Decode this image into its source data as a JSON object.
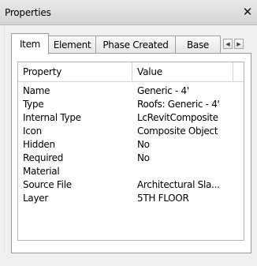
{
  "window": {
    "title": "Properties",
    "close_glyph": "✕"
  },
  "tabs": [
    {
      "label": "Item",
      "active": true
    },
    {
      "label": "Element",
      "active": false
    },
    {
      "label": "Phase Created",
      "active": false
    },
    {
      "label": "Base",
      "active": false
    }
  ],
  "tab_scroll": {
    "left_icon": "scroll-left-icon",
    "right_icon": "scroll-right-icon",
    "left_glyph": "◀",
    "right_glyph": "▶"
  },
  "grid": {
    "headers": {
      "property": "Property",
      "value": "Value"
    },
    "rows": [
      {
        "property": "Name",
        "value": "Generic - 4'"
      },
      {
        "property": "Type",
        "value": "Roofs: Generic - 4'"
      },
      {
        "property": "Internal Type",
        "value": "LcRevitComposite"
      },
      {
        "property": "Icon",
        "value": "Composite Object"
      },
      {
        "property": "Hidden",
        "value": "No"
      },
      {
        "property": "Required",
        "value": "No"
      },
      {
        "property": "Material",
        "value": ""
      },
      {
        "property": "Source File",
        "value": "Architectural Sla..."
      },
      {
        "property": "Layer",
        "value": "5TH FLOOR"
      }
    ]
  }
}
